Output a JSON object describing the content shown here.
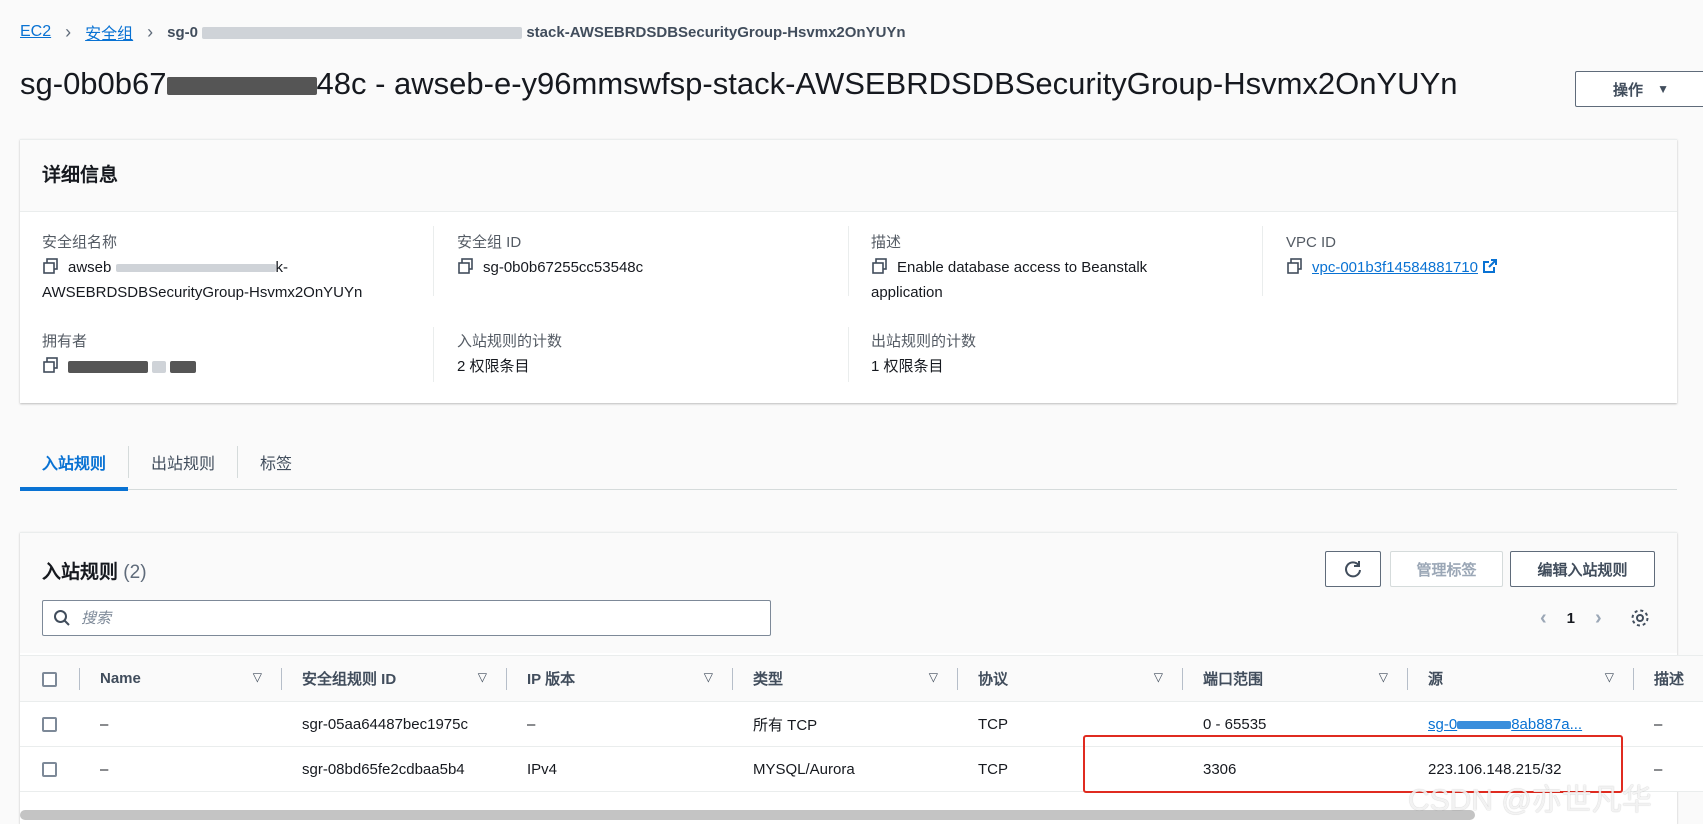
{
  "breadcrumb": {
    "ec2": "EC2",
    "security_groups": "安全组",
    "current_prefix": "sg-0",
    "current_suffix": "stack-AWSEBRDSDBSecurityGroup-Hsvmx2OnYUYn"
  },
  "page": {
    "title_prefix": "sg-0b0b67",
    "title_mid": "48c - awseb-e-y96mmswfsp-stack-AWSEBRDSDBSecurityGroup-Hsvmx2OnYUYn",
    "actions_label": "操作"
  },
  "details": {
    "heading": "详细信息",
    "sg_name_label": "安全组名称",
    "sg_name_line1": "awseb",
    "sg_name_line1_tail": "k-",
    "sg_name_line2": "AWSEBRDSDBSecurityGroup-Hsvmx2OnYUYn",
    "sg_id_label": "安全组 ID",
    "sg_id_value": "sg-0b0b67255cc53548c",
    "desc_label": "描述",
    "desc_line1": "Enable database access to Beanstalk",
    "desc_line2": "application",
    "vpc_label": "VPC ID",
    "vpc_value": "vpc-001b3f14584881710",
    "owner_label": "拥有者",
    "inbound_count_label": "入站规则的计数",
    "inbound_count_value": "2 权限条目",
    "outbound_count_label": "出站规则的计数",
    "outbound_count_value": "1 权限条目"
  },
  "tabs": [
    {
      "label": "入站规则",
      "active": true
    },
    {
      "label": "出站规则",
      "active": false
    },
    {
      "label": "标签",
      "active": false
    }
  ],
  "rules": {
    "title": "入站规则",
    "count": "(2)",
    "manage_tags_label": "管理标签",
    "edit_rules_label": "编辑入站规则",
    "search_placeholder": "搜索",
    "page_number": "1",
    "columns": [
      "Name",
      "安全组规则 ID",
      "IP 版本",
      "类型",
      "协议",
      "端口范围",
      "源",
      "描述"
    ],
    "rows": [
      {
        "name": "–",
        "rule_id": "sgr-05aa64487bec1975c",
        "ip_version": "–",
        "type": "所有 TCP",
        "protocol": "TCP",
        "port_range": "0 - 65535",
        "source": "sg-0",
        "source_tail": "8ab887a...",
        "description": "–"
      },
      {
        "name": "–",
        "rule_id": "sgr-08bd65fe2cdbaa5b4",
        "ip_version": "IPv4",
        "type": "MYSQL/Aurora",
        "protocol": "TCP",
        "port_range": "3306",
        "source": "223.106.148.215/32",
        "description": "–"
      }
    ]
  },
  "watermark": "CSDN @亦世凡华",
  "colors": {
    "link": "#0972d3",
    "highlight": "#e02b20"
  }
}
